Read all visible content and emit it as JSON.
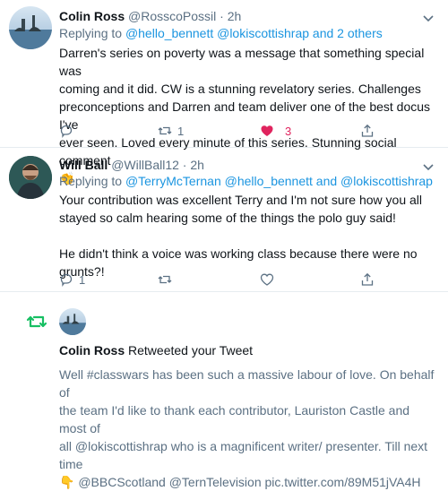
{
  "tweets": [
    {
      "name": "Colin Ross",
      "handle": "@RosscoPossil",
      "dot": "·",
      "time": "2h",
      "replying_prefix": "Replying to ",
      "replying_mentions": "@hello_bennett @lokiscottishrap and 2 others",
      "body_lines": [
        "Darren's series on poverty was a message that something special was",
        "coming and it did. CW is a stunning revelatory series. Challenges",
        "preconceptions and Darren and team deliver one of the best docus I've",
        "ever seen. Loved every minute of this series. Stunning social comment",
        "👏"
      ],
      "retweet_count": "1",
      "like_count": "3",
      "liked": true
    },
    {
      "name": "Will Ball",
      "handle": "@WillBall12",
      "dot": "·",
      "time": "2h",
      "replying_prefix": "Replying to ",
      "replying_mentions": "@TerryMcTernan @hello_bennett and @lokiscottishrap",
      "body_lines": [
        "Your contribution was excellent Terry and I'm not sure how you all",
        "stayed so calm hearing some of the things the polo guy said!",
        "",
        "He didn't think a voice was working class because there were no",
        "grunts?!"
      ],
      "reply_count": "1"
    }
  ],
  "retweet_notice": {
    "name": "Colin Ross",
    "action": " Retweeted your Tweet",
    "body_lines": [
      "Well #classwars has been such a massive labour of love. On behalf of",
      "the team I'd like to thank each contributor, Lauriston Castle and most of",
      "all @lokiscottishrap who is a magnificent writer/ presenter. Till next time",
      "👇 @BBCScotland @TernTelevision pic.twitter.com/89M51jVA4H"
    ]
  },
  "colors": {
    "accent": "#1b95e0",
    "like": "#e0245e",
    "retweet": "#17bf63",
    "muted": "#5b7083"
  },
  "icons": [
    "chevron-down-icon",
    "reply-icon",
    "retweet-icon",
    "like-icon",
    "share-icon"
  ]
}
